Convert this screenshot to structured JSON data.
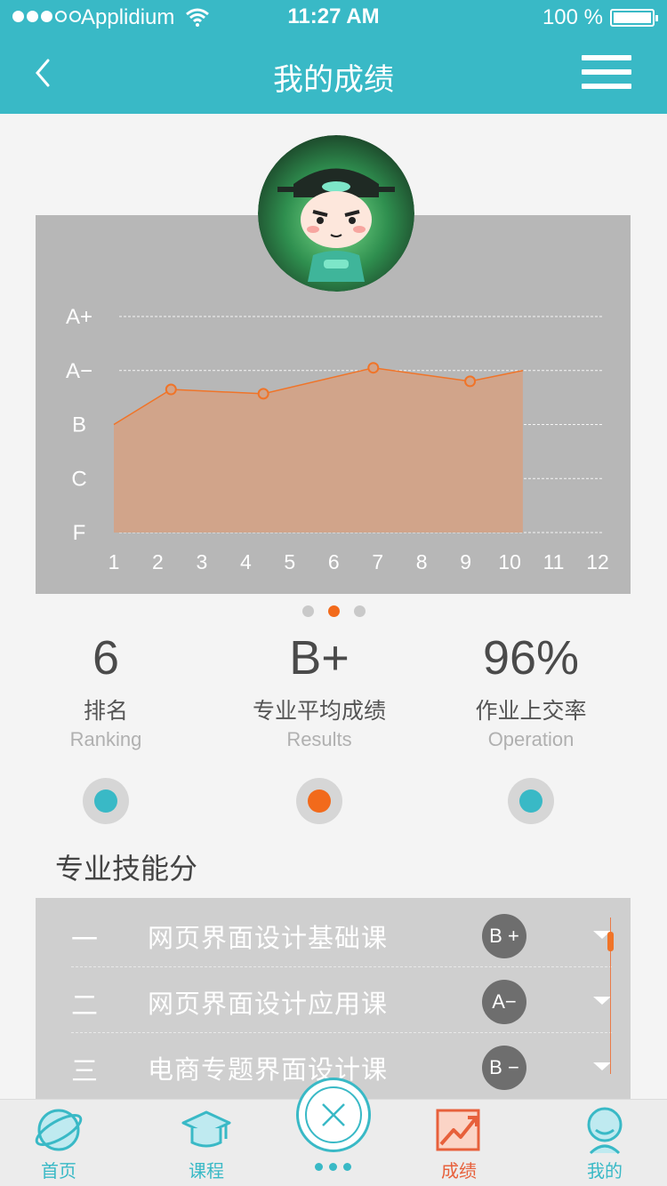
{
  "status_bar": {
    "carrier": "Applidium",
    "time": "11:27 AM",
    "battery": "100 %"
  },
  "nav": {
    "title": "我的成绩",
    "back_icon": "chevron-left-icon",
    "menu_icon": "hamburger-menu-icon"
  },
  "chart_data": {
    "type": "area",
    "y_categories": [
      "F",
      "C",
      "B",
      "A−",
      "A+"
    ],
    "x": [
      1,
      2.3,
      4.4,
      6.9,
      9.1,
      10.3
    ],
    "y": [
      2,
      2.65,
      2.57,
      3.05,
      2.8,
      3.0
    ],
    "x_ticks": [
      "1",
      "2",
      "3",
      "4",
      "5",
      "6",
      "7",
      "8",
      "9",
      "10",
      "11",
      "12"
    ],
    "xlim": [
      1,
      12
    ],
    "ylim": [
      0,
      4
    ],
    "marked_points": [
      1,
      2,
      3,
      4
    ],
    "colors": {
      "fill": "#d1a48a",
      "line": "#f07428",
      "background": "#b7b7b7",
      "grid": "#ffffff"
    },
    "grid": true
  },
  "pager": {
    "count": 3,
    "active": 1
  },
  "stats": [
    {
      "value": "6",
      "label_cn": "排名",
      "label_en": "Ranking",
      "color": "#39b9c6"
    },
    {
      "value": "B+",
      "label_cn": "专业平均成绩",
      "label_en": "Results",
      "color": "#f26a1b"
    },
    {
      "value": "96%",
      "label_cn": "作业上交率",
      "label_en": "Operation",
      "color": "#39b9c6"
    }
  ],
  "skills": {
    "title": "专业技能分",
    "items": [
      {
        "num": "一",
        "name": "网页界面设计基础课",
        "grade": "B +"
      },
      {
        "num": "二",
        "name": "网页界面设计应用课",
        "grade": "A−"
      },
      {
        "num": "三",
        "name": "电商专题界面设计课",
        "grade": "B −"
      }
    ]
  },
  "tabs": [
    {
      "label": "首页",
      "icon": "planet-icon"
    },
    {
      "label": "课程",
      "icon": "graduation-cap-icon"
    },
    {
      "label": "成绩",
      "icon": "trend-chart-icon"
    },
    {
      "label": "我的",
      "icon": "user-avatar-icon"
    }
  ],
  "center_button": {
    "icon": "close-icon"
  }
}
